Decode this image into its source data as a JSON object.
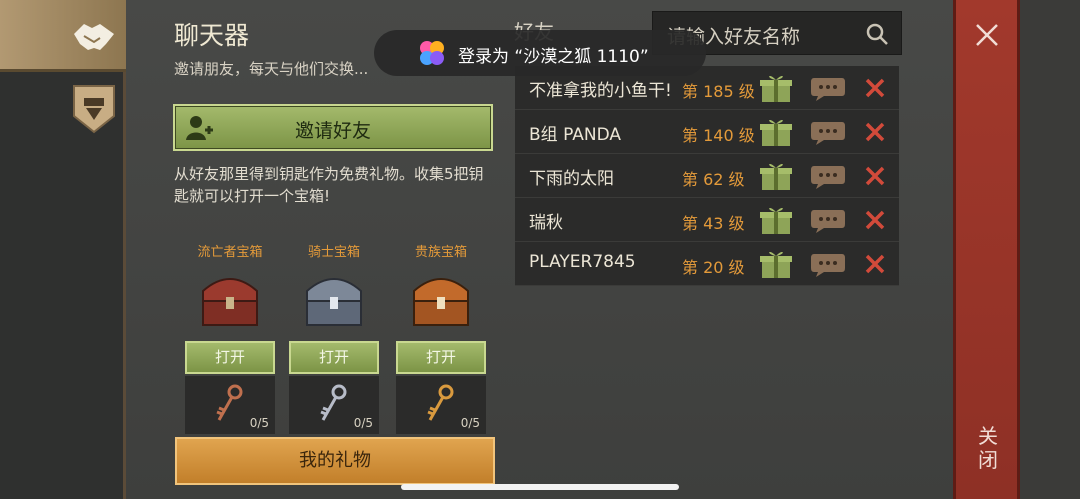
{
  "panel": {
    "title": "聊天器",
    "subtitle": "邀请朋友，每天与他们交换...",
    "invite_label": "邀请好友",
    "description": "从好友那里得到钥匙作为免费礼物。收集5把钥匙就可以打开一个宝箱!",
    "chests": [
      {
        "name": "流亡者宝箱",
        "open_label": "打开",
        "keys": "0/5",
        "color": "#9b3a2e"
      },
      {
        "name": "骑士宝箱",
        "open_label": "打开",
        "keys": "0/5",
        "color": "#7d8898"
      },
      {
        "name": "贵族宝箱",
        "open_label": "打开",
        "keys": "0/5",
        "color": "#c26a2b"
      }
    ],
    "my_gifts_label": "我的礼物"
  },
  "friends": {
    "heading": "好友",
    "search_placeholder": "请输入好友名称",
    "list": [
      {
        "name": "不准拿我的小鱼干!",
        "level": "第 185 级"
      },
      {
        "name": "B组 PANDA",
        "level": "第 140 级"
      },
      {
        "name": "下雨的太阳",
        "level": "第 62 级"
      },
      {
        "name": "瑞秋",
        "level": "第 43 级"
      },
      {
        "name": "PLAYER7845",
        "level": "第 20 级"
      }
    ]
  },
  "close_label": "关闭",
  "toast": {
    "text": "登录为 “沙漠之狐 1110”"
  },
  "colors": {
    "accent_green": "#8ea458",
    "accent_orange": "#e39a3a",
    "close_red": "#a2392c"
  },
  "icons": [
    "handshake-icon",
    "guild-shield-icon",
    "add-friend-icon",
    "search-icon",
    "gift-icon",
    "chat-bubble-icon",
    "remove-icon",
    "close-icon",
    "key-icon",
    "chest-icon"
  ]
}
